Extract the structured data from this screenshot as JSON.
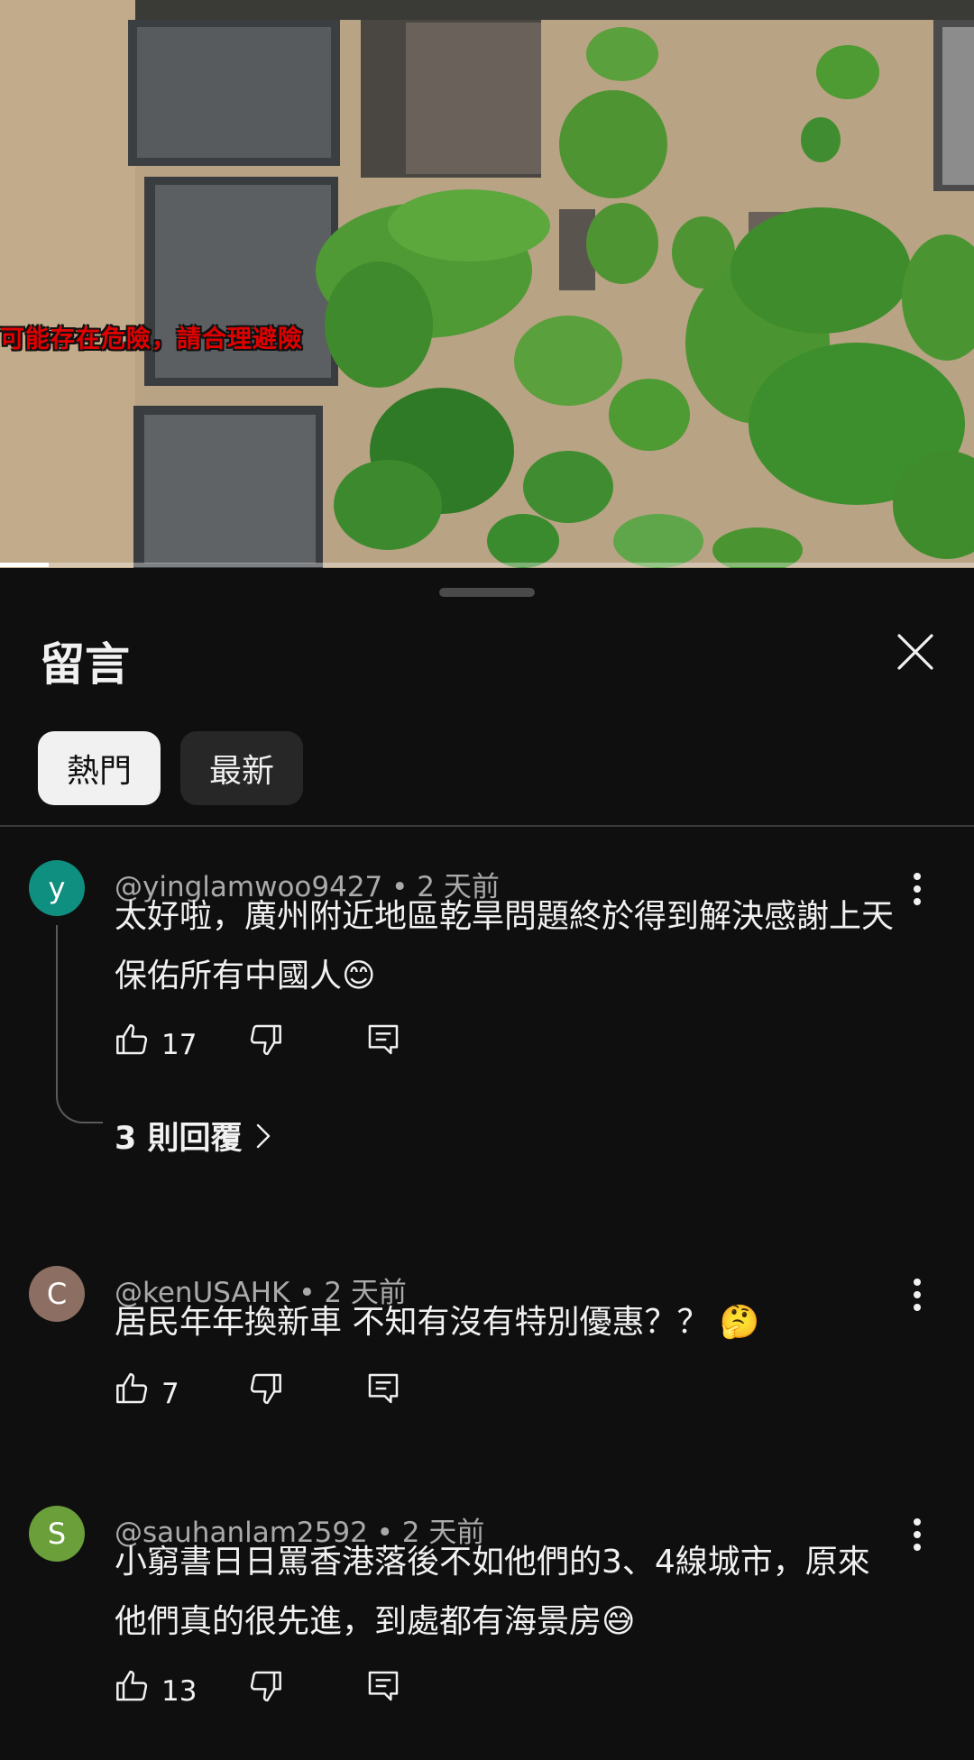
{
  "video": {
    "overlay_text": "可能存在危險，請合理避險",
    "progress_fraction": 0.05
  },
  "comments_panel": {
    "title": "留言",
    "sort_chips": [
      {
        "label": "熱門",
        "active": true
      },
      {
        "label": "最新",
        "active": false
      }
    ],
    "comments": [
      {
        "avatar_letter": "y",
        "avatar_color": "#0f8f7f",
        "author": "@yinglamwoo9427",
        "time": "2 天前",
        "text": "太好啦，廣州附近地區乾旱問題終於得到解決感謝上天保佑所有中國人😊",
        "likes": "17",
        "replies_label": "3 則回覆"
      },
      {
        "avatar_letter": "C",
        "avatar_color": "#8d6e63",
        "author": "@kenUSAHK",
        "time": "2 天前",
        "text": "居民年年換新車  不知有沒有特別優惠？？ 🤔",
        "likes": "7"
      },
      {
        "avatar_letter": "S",
        "avatar_color": "#6a9f3a",
        "author": "@sauhanlam2592",
        "time": "2 天前",
        "text": "小窮書日日罵香港落後不如他們的3、4線城市，原來他們真的很先進，到處都有海景房😅",
        "likes": "13"
      }
    ]
  }
}
